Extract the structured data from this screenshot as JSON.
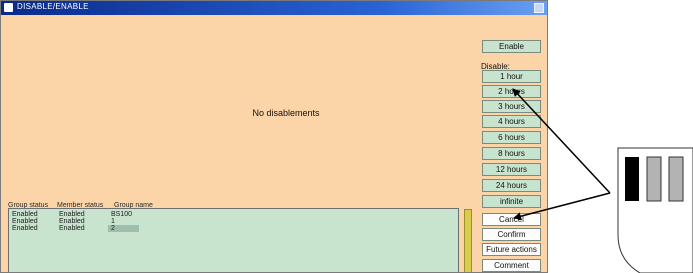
{
  "window": {
    "title": "DISABLE/ENABLE"
  },
  "main": {
    "message": "No disablements"
  },
  "buttons": {
    "enable": "Enable",
    "disable_label": "Disable:",
    "durations": [
      "1 hour",
      "2 hours",
      "3 hours",
      "4 hours",
      "6 hours",
      "8 hours",
      "12 hours",
      "24 hours",
      "infinite"
    ],
    "cancel": "Cancel",
    "confirm": "Confirm",
    "future_actions": "Future actions",
    "comment": "Comment"
  },
  "groups": {
    "headers": [
      "Group status",
      "Member status",
      "Group name"
    ],
    "rows": [
      {
        "group_status": "Enabled",
        "member_status": "Enabled",
        "group_name": "BS100"
      },
      {
        "group_status": "Enabled",
        "member_status": "Enabled",
        "group_name": "1"
      },
      {
        "group_status": "Enabled",
        "member_status": "Enabled",
        "group_name": "2"
      }
    ]
  },
  "inset": {
    "stripe_colors": [
      "#000000",
      "#b3b3b3",
      "#b3b3b3"
    ]
  }
}
